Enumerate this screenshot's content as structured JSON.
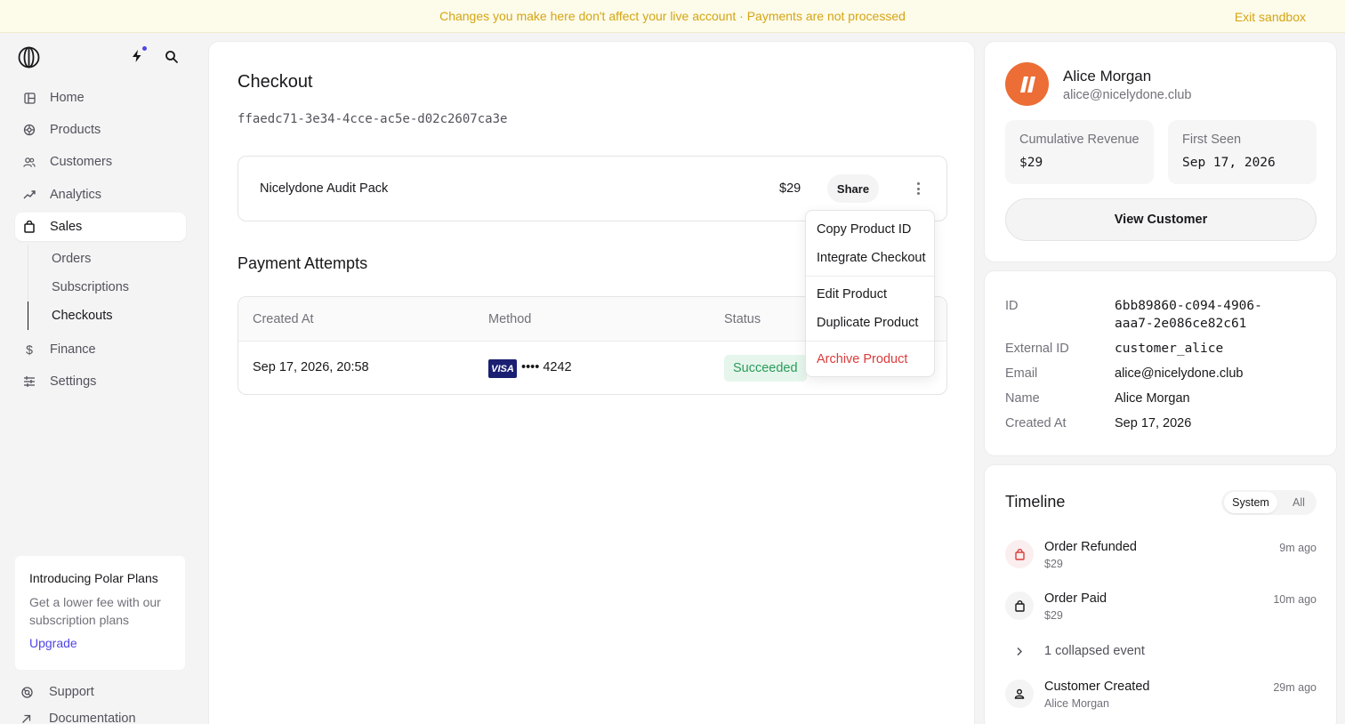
{
  "banner": {
    "message": "Changes you make here don't affect your live account · Payments are not processed",
    "exit_label": "Exit sandbox"
  },
  "sidebar": {
    "items": [
      {
        "label": "Home",
        "icon": "home-icon"
      },
      {
        "label": "Products",
        "icon": "products-icon"
      },
      {
        "label": "Customers",
        "icon": "customers-icon"
      },
      {
        "label": "Analytics",
        "icon": "analytics-icon"
      },
      {
        "label": "Sales",
        "icon": "sales-icon"
      }
    ],
    "sub_items": [
      {
        "label": "Orders"
      },
      {
        "label": "Subscriptions"
      },
      {
        "label": "Checkouts"
      }
    ],
    "items_after": [
      {
        "label": "Finance",
        "icon": "dollar-icon"
      },
      {
        "label": "Settings",
        "icon": "sliders-icon"
      }
    ],
    "promo": {
      "title": "Introducing Polar Plans",
      "description": "Get a lower fee with our subscription plans",
      "cta": "Upgrade"
    },
    "bottom": [
      {
        "label": "Support",
        "icon": "support-icon"
      },
      {
        "label": "Documentation",
        "icon": "external-arrow-icon"
      }
    ]
  },
  "checkout": {
    "title": "Checkout",
    "id": "ffaedc71-3e34-4cce-ac5e-d02c2607ca3e",
    "product": {
      "name": "Nicelydone Audit Pack",
      "price": "$29",
      "share_label": "Share"
    },
    "payments": {
      "title": "Payment Attempts",
      "columns": [
        "Created At",
        "Method",
        "Status"
      ],
      "rows": [
        {
          "created_at": "Sep 17, 2026, 20:58",
          "card_brand": "VISA",
          "card_last4": "•••• 4242",
          "status": "Succeeded"
        }
      ]
    }
  },
  "menu": {
    "items": [
      {
        "label": "Copy Product ID"
      },
      {
        "label": "Integrate Checkout"
      },
      {
        "label": "Edit Product"
      },
      {
        "label": "Duplicate Product"
      },
      {
        "label": "Archive Product"
      }
    ]
  },
  "customer": {
    "name": "Alice Morgan",
    "email": "alice@nicelydone.club",
    "stats": [
      {
        "label": "Cumulative Revenue",
        "value": "$29"
      },
      {
        "label": "First Seen",
        "value": "Sep 17, 2026"
      }
    ],
    "view_label": "View Customer",
    "details": [
      {
        "label": "ID",
        "value": "6bb89860-c094-4906-",
        "value2": "aaa7-2e086ce82c61"
      },
      {
        "label": "External ID",
        "value": "customer_alice"
      },
      {
        "label": "Email",
        "value": "alice@nicelydone.club"
      },
      {
        "label": "Name",
        "value": "Alice Morgan"
      },
      {
        "label": "Created At",
        "value": "Sep 17, 2026"
      }
    ]
  },
  "timeline": {
    "title": "Timeline",
    "filters": [
      "System",
      "All"
    ],
    "events": [
      {
        "title": "Order Refunded",
        "sub": "$29",
        "ago": "9m ago",
        "icon": "bag-icon"
      },
      {
        "title": "Order Paid",
        "sub": "$29",
        "ago": "10m ago",
        "icon": "bag-icon"
      },
      {
        "title": "Customer Created",
        "sub": "Alice Morgan",
        "ago": "29m ago",
        "icon": "user-icon"
      }
    ],
    "collapsed": "1 collapsed event"
  },
  "colors": {
    "banner_text": "#d4a515",
    "accent": "#4f46e5",
    "success": "#2a9b5b",
    "danger": "#dc3b3b",
    "avatar": "#ec6d36"
  }
}
